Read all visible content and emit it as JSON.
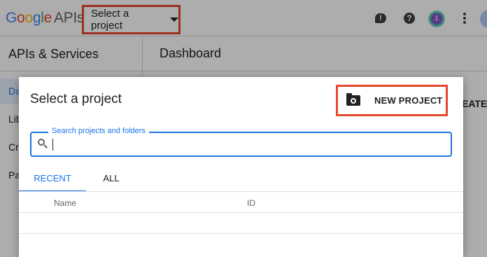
{
  "topbar": {
    "logo_google": "Google",
    "logo_apis": "APIs",
    "project_select_label": "Select a project",
    "notification_count": "1"
  },
  "nav": {
    "title": "APIs & Services",
    "items": [
      {
        "label": "Da"
      },
      {
        "label": "Lib"
      },
      {
        "label": "Cre"
      },
      {
        "label": "Pa"
      }
    ]
  },
  "page": {
    "title": "Dashboard",
    "create_label": "EATE"
  },
  "dialog": {
    "title": "Select a project",
    "new_project_label": "NEW PROJECT",
    "search_label": "Search projects and folders",
    "search_value": "",
    "tabs": [
      {
        "label": "RECENT",
        "active": true
      },
      {
        "label": "ALL",
        "active": false
      }
    ],
    "columns": {
      "name": "Name",
      "id": "ID"
    }
  },
  "colors": {
    "accent": "#1a73e8",
    "highlight": "#e8472d"
  },
  "icons": [
    "feedback-icon",
    "help-icon",
    "kebab-menu-icon",
    "folder-settings-icon",
    "search-icon",
    "dropdown-caret-icon"
  ]
}
